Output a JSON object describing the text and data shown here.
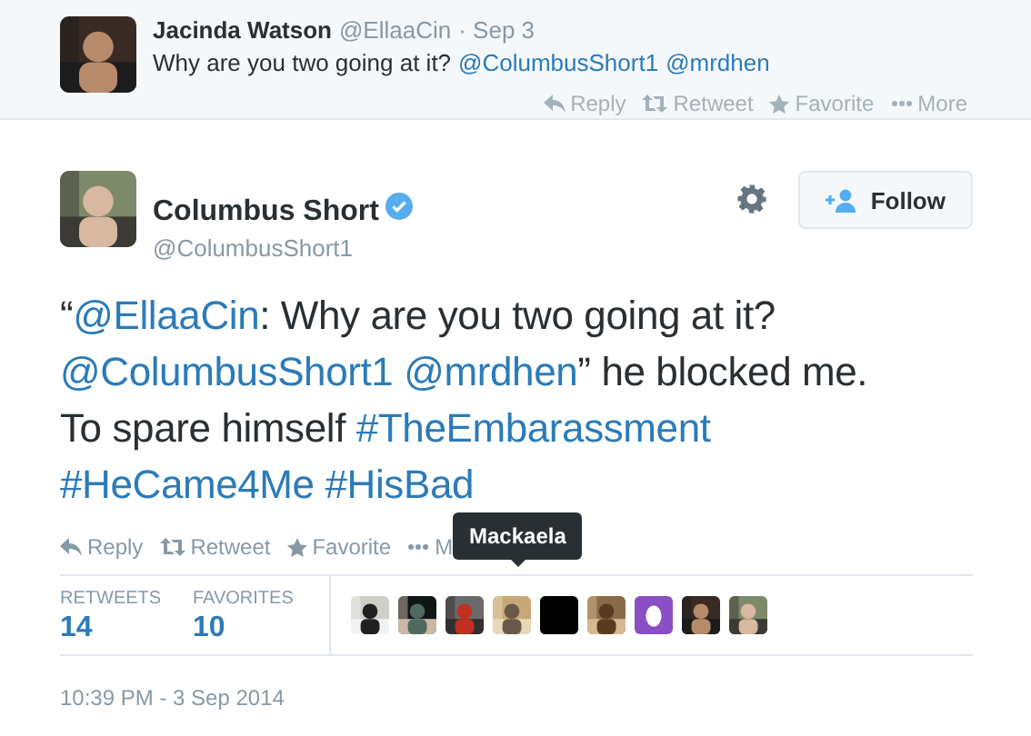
{
  "parent_tweet": {
    "name": "Jacinda Watson",
    "handle": "@EllaaCin",
    "time": "· Sep 3",
    "text": "Why are you two going at it?",
    "mentions": [
      "@ColumbusShort1",
      "@mrdhen"
    ],
    "actions": [
      "Reply",
      "Retweet",
      "Favorite",
      "More"
    ]
  },
  "tweet": {
    "name": "Columbus Short",
    "verified": true,
    "handle": "@ColumbusShort1",
    "follow_label": "Follow",
    "text_parts": [
      {
        "kind": "plain",
        "text": "“"
      },
      {
        "kind": "link",
        "text": "@EllaaCin"
      },
      {
        "kind": "plain",
        "text": ": Why are you two going at it? "
      },
      {
        "kind": "link",
        "text": "@ColumbusShort1"
      },
      {
        "kind": "link",
        "text": "@mrdhen"
      },
      {
        "kind": "plain",
        "text": "” he blocked me. To spare himself "
      },
      {
        "kind": "link",
        "text": "#TheEmbarassment"
      },
      {
        "kind": "link",
        "text": "#HeCame4Me"
      },
      {
        "kind": "link",
        "text": "#HisBad"
      }
    ],
    "actions": [
      "Reply",
      "Retweet",
      "Favorite",
      "M"
    ],
    "stats": [
      {
        "label": "RETWEETS",
        "value": "14"
      },
      {
        "label": "FAVORITES",
        "value": "10"
      }
    ],
    "favoriters": [
      {
        "kind": "picture"
      },
      {
        "kind": "picture"
      },
      {
        "kind": "picture"
      },
      {
        "kind": "picture"
      },
      {
        "kind": "picture"
      },
      {
        "kind": "picture"
      },
      {
        "kind": "egg",
        "color": "#8a4fc4"
      },
      {
        "kind": "picture"
      },
      {
        "kind": "picture"
      }
    ],
    "tooltip": "Mackaela",
    "timestamp": "10:39 PM - 3 Sep 2014"
  }
}
